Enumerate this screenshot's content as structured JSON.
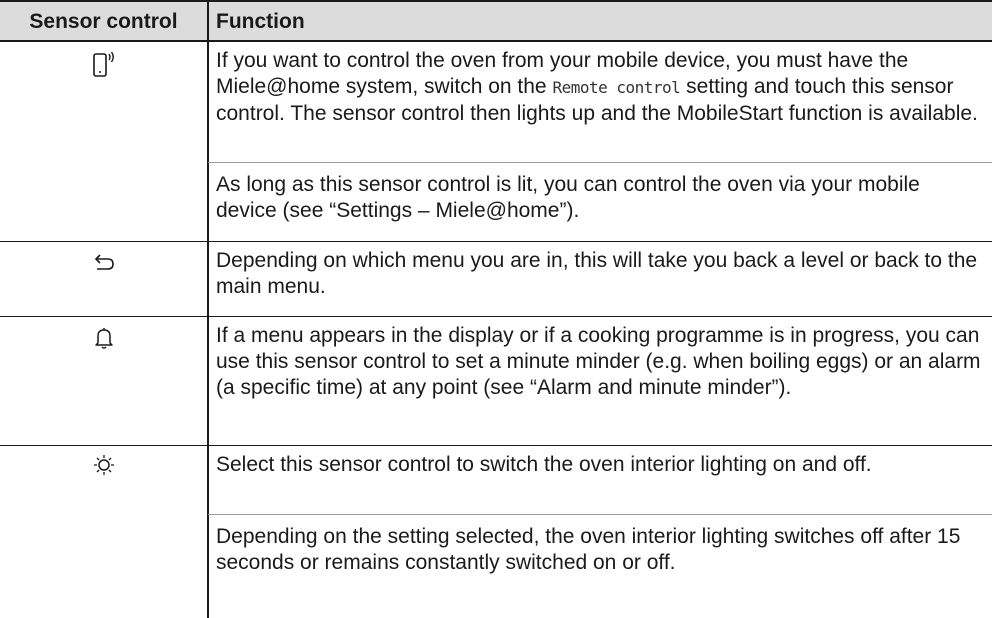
{
  "table": {
    "headers": {
      "sensor": "Sensor control",
      "function": "Function"
    },
    "rows": [
      {
        "icon": "mobile-start-icon",
        "p1_a": "If you want to control the oven from your mobile device, you must have the Miele@home system, switch on the ",
        "p1_term": "Remote control",
        "p1_b": " setting and touch this sensor control. The sensor control then lights up and the MobileStart function is available.",
        "p2": "As long as this sensor control is lit, you can control the oven via your mobile device (see “Settings – Miele@home”)."
      },
      {
        "icon": "back-arrow-icon",
        "p1": "Depending on which menu you are in, this will take you back a level or back to the main menu."
      },
      {
        "icon": "bell-icon",
        "p1": "If a menu appears in the display or if a cooking programme is in progress, you can use this sensor control to set a minute minder (e.g. when boiling eggs) or an alarm (a specific time) at any point (see “Alarm and minute minder”)."
      },
      {
        "icon": "light-icon",
        "p1": "Select this sensor control to switch the oven interior lighting on and off.",
        "p2": "Depending on the setting selected, the oven interior lighting switches off after 15 seconds or remains constantly switched on or off."
      }
    ]
  }
}
